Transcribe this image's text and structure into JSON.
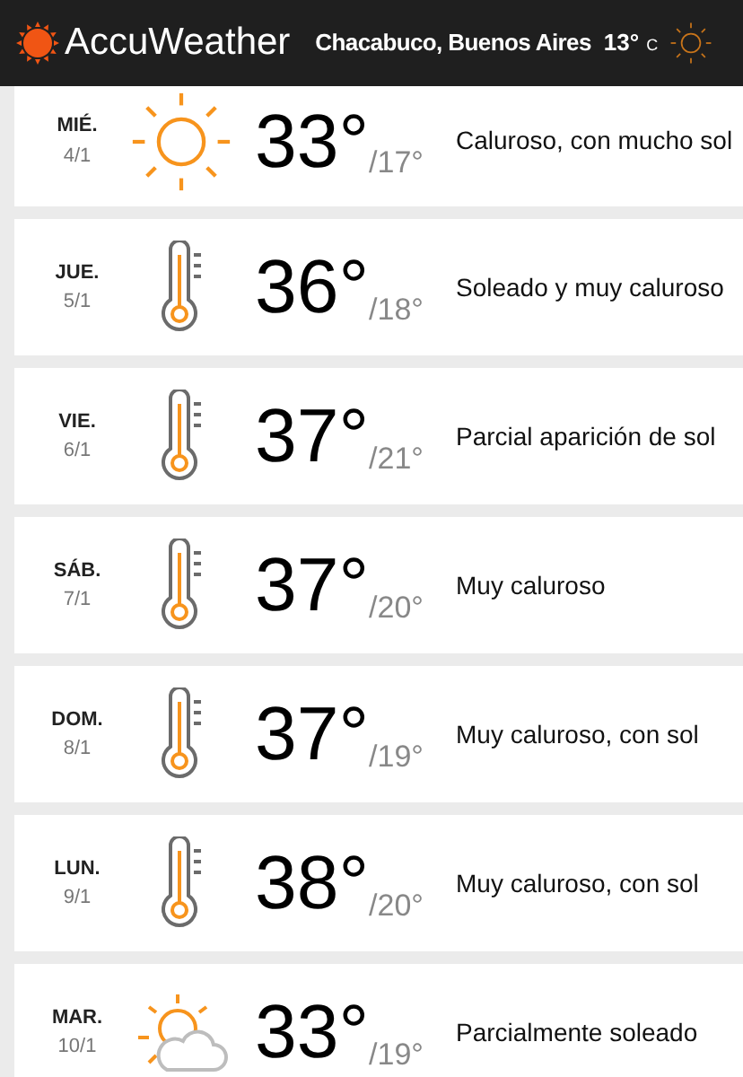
{
  "header": {
    "brand": "AccuWeather",
    "location": "Chacabuco, Buenos Aires",
    "current_temp": "13°",
    "unit": "C"
  },
  "days": [
    {
      "day": "MIÉ.",
      "date": "4/1",
      "kind": "sun",
      "high": "33°",
      "low": "/17°",
      "description": "Caluroso, con mucho sol"
    },
    {
      "day": "JUE.",
      "date": "5/1",
      "kind": "thermometer",
      "high": "36°",
      "low": "/18°",
      "description": "Soleado y muy caluroso"
    },
    {
      "day": "VIE.",
      "date": "6/1",
      "kind": "thermometer",
      "high": "37°",
      "low": "/21°",
      "description": "Parcial aparición de sol"
    },
    {
      "day": "SÁB.",
      "date": "7/1",
      "kind": "thermometer",
      "high": "37°",
      "low": "/20°",
      "description": "Muy caluroso"
    },
    {
      "day": "DOM.",
      "date": "8/1",
      "kind": "thermometer",
      "high": "37°",
      "low": "/19°",
      "description": "Muy caluroso, con sol"
    },
    {
      "day": "LUN.",
      "date": "9/1",
      "kind": "thermometer",
      "high": "38°",
      "low": "/20°",
      "description": "Muy caluroso, con sol"
    },
    {
      "day": "MAR.",
      "date": "10/1",
      "kind": "partly-sunny",
      "high": "33°",
      "low": "/19°",
      "description": "Parcialmente soleado"
    }
  ]
}
